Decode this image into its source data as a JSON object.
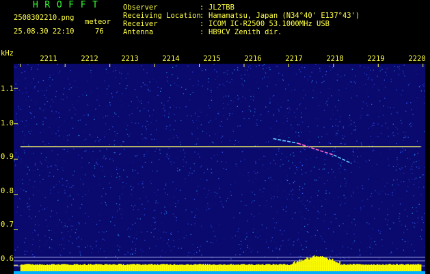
{
  "header": {
    "brand": "HROFFT",
    "filename": "2508302210.png",
    "mode": "meteor",
    "datetime": "25.08.30 22:10",
    "count": "76",
    "observer_label": "Observer",
    "observer_value": "JL2TBB",
    "location_label": "Receiving Location",
    "location_value": "Hamamatsu, Japan (N34°40' E137°43')",
    "receiver_label": "Receiver",
    "receiver_value": "ICOM IC-R2500 53.1000MHz USB",
    "antenna_label": "Antenna",
    "antenna_value": "HB9CV Zenith dir.",
    "colon": ":"
  },
  "axis": {
    "y_unit": "kHz",
    "y_ticks": [
      "1.1",
      "1.0",
      "0.9",
      "0.8",
      "0.7",
      "0.6"
    ],
    "x_ticks": [
      "2211",
      "2212",
      "2213",
      "2214",
      "2215",
      "2216",
      "2217",
      "2218",
      "2219",
      "2220"
    ]
  },
  "colors": {
    "background": "#000000",
    "text": "#ffff44",
    "brand": "#33ff33",
    "spectrogram_bg": "#0a0a6e",
    "carrier": "#ffff66",
    "signal_bar": "#ffff00",
    "signal_base": "#00b0ff"
  },
  "chart_data": {
    "type": "heatmap",
    "x_axis_label": "",
    "y_axis_label": "kHz",
    "ylim": [
      0.575,
      1.17
    ],
    "xlim": [
      2210.85,
      2220.05
    ],
    "carrier": {
      "freq_khz": 0.935,
      "x_start": 2211.0,
      "x_end": 2219.95
    },
    "meteor_echo": [
      {
        "x": 2216.65,
        "y": 0.958
      },
      {
        "x": 2217.2,
        "y": 0.945
      },
      {
        "x": 2217.6,
        "y": 0.928
      },
      {
        "x": 2218.0,
        "y": 0.912
      },
      {
        "x": 2218.4,
        "y": 0.888
      }
    ],
    "reference_lines_khz": [
      0.623,
      0.612,
      0.598
    ]
  }
}
